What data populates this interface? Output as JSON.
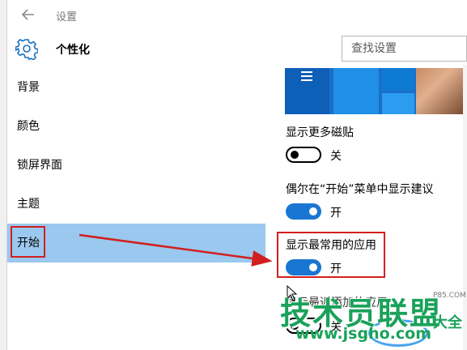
{
  "window": {
    "title": "设置"
  },
  "header": {
    "title": "个性化"
  },
  "search": {
    "placeholder": "查找设置"
  },
  "sidebar": {
    "items": [
      {
        "label": "背景"
      },
      {
        "label": "颜色"
      },
      {
        "label": "锁屏界面"
      },
      {
        "label": "主题"
      },
      {
        "label": "开始",
        "selected": true
      }
    ]
  },
  "settings": [
    {
      "label": "显示更多磁贴",
      "state": "关"
    },
    {
      "label": "偶尔在“开始”菜单中显示建议",
      "state": "开"
    },
    {
      "label": "显示最常用的应用",
      "state": "开"
    }
  ],
  "partial_setting": {
    "label": "显示最近添加的应用",
    "state": "关"
  },
  "watermark": {
    "main": "技术员联盟",
    "suffix": "大全",
    "url": "www.jsgho.com",
    "small": "P85.COM"
  },
  "colors": {
    "accent": "#1976d2",
    "selected_bg": "#9ac8ee",
    "annotation": "#d11f1f",
    "watermark": "#1aa25a"
  },
  "icons": {
    "back": "back-arrow-icon",
    "header": "gear-icon",
    "cursor": "mouse-cursor-icon"
  }
}
